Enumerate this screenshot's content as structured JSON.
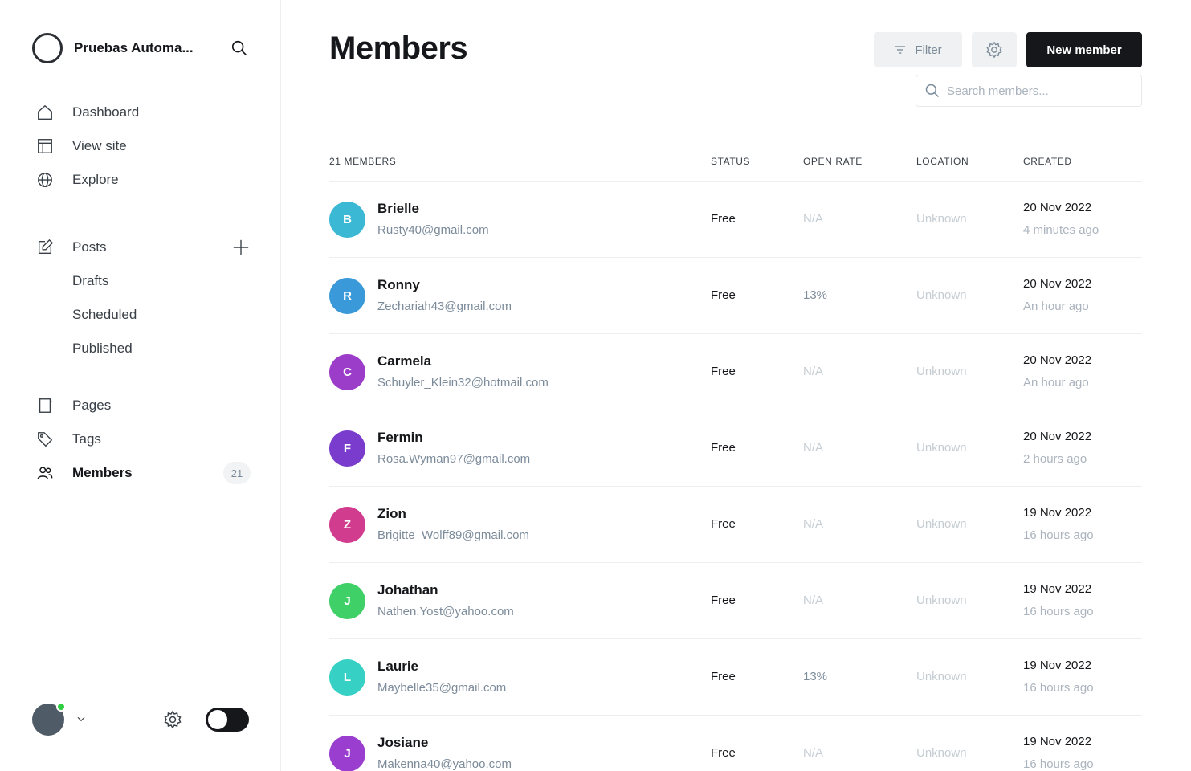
{
  "site": {
    "title": "Pruebas Automa..."
  },
  "nav": {
    "dashboard": "Dashboard",
    "view_site": "View site",
    "explore": "Explore",
    "posts": "Posts",
    "drafts": "Drafts",
    "scheduled": "Scheduled",
    "published": "Published",
    "pages": "Pages",
    "tags": "Tags",
    "members": "Members",
    "members_count": "21"
  },
  "page": {
    "title": "Members",
    "filter_label": "Filter",
    "new_member_label": "New member",
    "search_placeholder": "Search members..."
  },
  "table": {
    "headers": {
      "name": "21 MEMBERS",
      "status": "STATUS",
      "open_rate": "OPEN RATE",
      "location": "LOCATION",
      "created": "CREATED"
    },
    "rows": [
      {
        "initial": "B",
        "color": "#3bb8d4",
        "name": "Brielle",
        "email": "Rusty40@gmail.com",
        "status": "Free",
        "open_rate": "N/A",
        "location": "Unknown",
        "created": "20 Nov 2022",
        "ago": "4 minutes ago"
      },
      {
        "initial": "R",
        "color": "#3a9ad9",
        "name": "Ronny",
        "email": "Zechariah43@gmail.com",
        "status": "Free",
        "open_rate": "13%",
        "location": "Unknown",
        "created": "20 Nov 2022",
        "ago": "An hour ago"
      },
      {
        "initial": "C",
        "color": "#9b3dc9",
        "name": "Carmela",
        "email": "Schuyler_Klein32@hotmail.com",
        "status": "Free",
        "open_rate": "N/A",
        "location": "Unknown",
        "created": "20 Nov 2022",
        "ago": "An hour ago"
      },
      {
        "initial": "F",
        "color": "#7a3ccc",
        "name": "Fermin",
        "email": "Rosa.Wyman97@gmail.com",
        "status": "Free",
        "open_rate": "N/A",
        "location": "Unknown",
        "created": "20 Nov 2022",
        "ago": "2 hours ago"
      },
      {
        "initial": "Z",
        "color": "#d13c8f",
        "name": "Zion",
        "email": "Brigitte_Wolff89@gmail.com",
        "status": "Free",
        "open_rate": "N/A",
        "location": "Unknown",
        "created": "19 Nov 2022",
        "ago": "16 hours ago"
      },
      {
        "initial": "J",
        "color": "#3fd068",
        "name": "Johathan",
        "email": "Nathen.Yost@yahoo.com",
        "status": "Free",
        "open_rate": "N/A",
        "location": "Unknown",
        "created": "19 Nov 2022",
        "ago": "16 hours ago"
      },
      {
        "initial": "L",
        "color": "#36d1c4",
        "name": "Laurie",
        "email": "Maybelle35@gmail.com",
        "status": "Free",
        "open_rate": "13%",
        "location": "Unknown",
        "created": "19 Nov 2022",
        "ago": "16 hours ago"
      },
      {
        "initial": "J",
        "color": "#9a3ecf",
        "name": "Josiane",
        "email": "Makenna40@yahoo.com",
        "status": "Free",
        "open_rate": "N/A",
        "location": "Unknown",
        "created": "19 Nov 2022",
        "ago": "16 hours ago"
      }
    ]
  },
  "icons": {
    "search": "search-icon",
    "home": "home-icon",
    "view_site": "layout-icon",
    "explore": "globe-icon",
    "posts": "edit-icon",
    "add": "plus-icon",
    "pages": "page-icon",
    "tags": "tag-icon",
    "members": "users-icon",
    "settings": "gear-icon",
    "filter": "filter-icon",
    "chevron": "chevron-down-icon"
  }
}
